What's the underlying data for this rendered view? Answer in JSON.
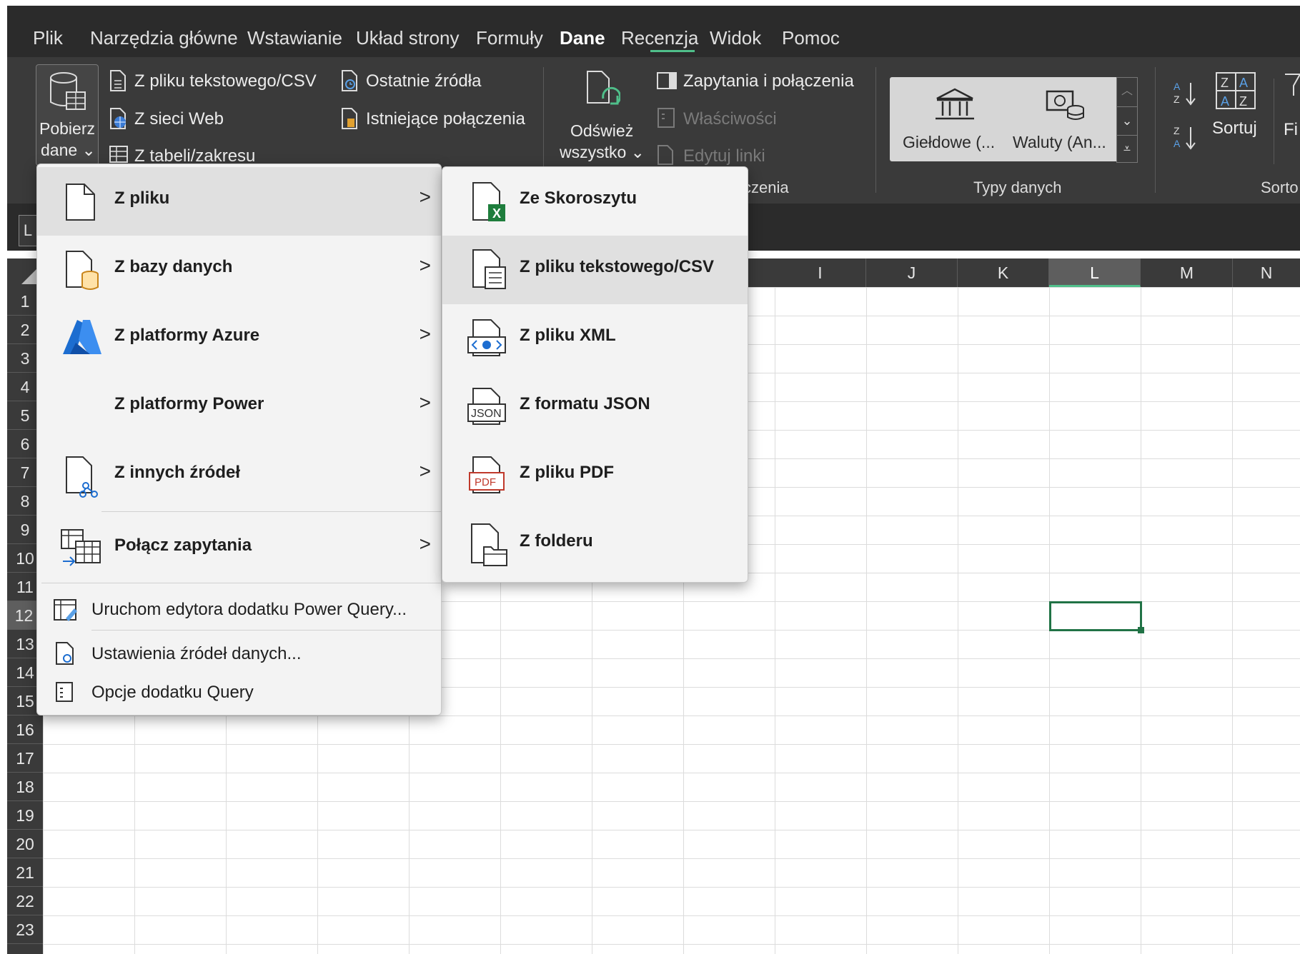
{
  "menu_tabs": [
    "Plik",
    "Narzędzia główne",
    "Wstawianie",
    "Układ strony",
    "Formuły",
    "Dane",
    "Recenzja",
    "Widok",
    "Pomoc"
  ],
  "active_tab": "Dane",
  "ribbon": {
    "get_data": {
      "line1": "Pobierz",
      "line2": "dane ⌄"
    },
    "from_text_csv": "Z pliku tekstowego/CSV",
    "from_web": "Z sieci Web",
    "from_table": "Z tabeli/zakresu",
    "recent_sources": "Ostatnie źródła",
    "existing_connections": "Istniejące połączenia",
    "refresh_all": {
      "line1": "Odśwież",
      "line2": "wszystko ⌄"
    },
    "queries_connections": "Zapytania i połączenia",
    "properties": "Właściwości",
    "edit_links": "Edytuj linki",
    "queries_group_label_partial": "czenia",
    "stocks": "Giełdowe (...",
    "currencies": "Waluty (An...",
    "data_types_label": "Typy danych",
    "sort": "Sortuj",
    "filter_partial": "Fi",
    "sort_group_partial": "Sorto"
  },
  "name_box": "L",
  "columns": [
    "I",
    "J",
    "K",
    "L",
    "M",
    "N"
  ],
  "selected_column": "L",
  "rows": [
    "1",
    "2",
    "3",
    "4",
    "5",
    "6",
    "7",
    "8",
    "9",
    "10",
    "11",
    "12",
    "13",
    "14",
    "15",
    "16",
    "17",
    "18",
    "19",
    "20",
    "21",
    "22",
    "23"
  ],
  "selected_row": "12",
  "main_menu": {
    "items": [
      {
        "label": "Z pliku",
        "icon": "file-icon",
        "has_submenu": true,
        "highlighted": true
      },
      {
        "label": "Z bazy danych",
        "icon": "database-file-icon",
        "has_submenu": true
      },
      {
        "label": "Z platformy Azure",
        "icon": "azure-icon",
        "has_submenu": true
      },
      {
        "label": "Z platformy Power",
        "icon": "",
        "has_submenu": true
      },
      {
        "label": "Z innych źródeł",
        "icon": "other-sources-icon",
        "has_submenu": true
      },
      {
        "label": "Połącz zapytania",
        "icon": "combine-queries-icon",
        "has_submenu": true
      }
    ],
    "actions": [
      {
        "label": "Uruchom edytora dodatku Power Query...",
        "icon": "power-query-editor-icon"
      },
      {
        "label": "Ustawienia źródeł danych...",
        "icon": "data-source-settings-icon"
      },
      {
        "label": "Opcje dodatku Query",
        "icon": "query-options-icon"
      }
    ],
    "arrow": ">"
  },
  "submenu": {
    "items": [
      {
        "label": "Ze Skoroszytu",
        "icon": "excel-workbook-icon"
      },
      {
        "label": "Z pliku tekstowego/CSV",
        "icon": "text-csv-icon",
        "highlighted": true
      },
      {
        "label": "Z pliku XML",
        "icon": "xml-icon"
      },
      {
        "label": "Z formatu JSON",
        "icon": "json-icon"
      },
      {
        "label": "Z pliku PDF",
        "icon": "pdf-icon"
      },
      {
        "label": "Z folderu",
        "icon": "folder-icon"
      }
    ]
  },
  "icon_texts": {
    "json": "JSON",
    "pdf": "PDF",
    "excel": "X"
  },
  "colors": {
    "accent_green": "#217346",
    "tab_underline": "#4fbf8a",
    "ribbon_bg": "#3a3a3a",
    "menu_bg": "#f3f3f3"
  }
}
